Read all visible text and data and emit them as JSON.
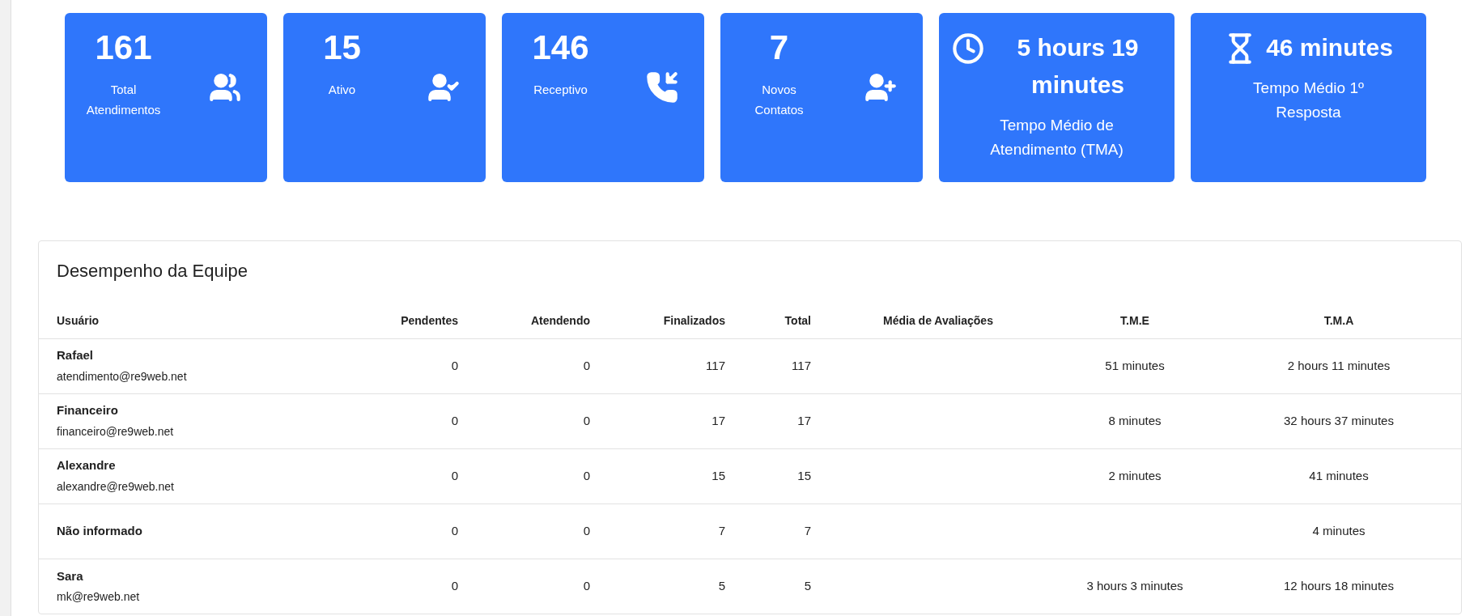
{
  "stat_cards": [
    {
      "kind": "side-icon",
      "value": "161",
      "label": "Total Atendimentos"
    },
    {
      "kind": "side-icon",
      "value": "15",
      "label": "Ativo"
    },
    {
      "kind": "side-icon",
      "value": "146",
      "label": "Receptivo"
    },
    {
      "kind": "side-icon",
      "value": "7",
      "label": "Novos Contatos"
    },
    {
      "kind": "inline-icon",
      "value": "5 hours 19 minutes",
      "label": "Tempo Médio de Atendimento (TMA)"
    },
    {
      "kind": "inline-icon",
      "value": "46 minutes",
      "label": "Tempo Médio 1º Resposta"
    }
  ],
  "team_table": {
    "title": "Desempenho da Equipe",
    "columns": [
      "Usuário",
      "Pendentes",
      "Atendendo",
      "Finalizados",
      "Total",
      "Média de Avaliações",
      "T.M.E",
      "T.M.A"
    ],
    "rows": [
      {
        "name": "Rafael",
        "email": "atendimento@re9web.net",
        "pendentes": "0",
        "atendendo": "0",
        "finalizados": "117",
        "total": "117",
        "tme": "51 minutes",
        "tma": "2 hours 11 minutes"
      },
      {
        "name": "Financeiro",
        "email": "financeiro@re9web.net",
        "pendentes": "0",
        "atendendo": "0",
        "finalizados": "17",
        "total": "17",
        "tme": "8 minutes",
        "tma": "32 hours 37 minutes"
      },
      {
        "name": "Alexandre",
        "email": "alexandre@re9web.net",
        "pendentes": "0",
        "atendendo": "0",
        "finalizados": "15",
        "total": "15",
        "tme": "2 minutes",
        "tma": "41 minutes"
      },
      {
        "name": "Não informado",
        "pendentes": "0",
        "atendendo": "0",
        "finalizados": "7",
        "total": "7",
        "tma": "4 minutes"
      },
      {
        "name": "Sara",
        "email": "mk@re9web.net",
        "pendentes": "0",
        "atendendo": "0",
        "finalizados": "5",
        "total": "5",
        "tme": "3 hours 3 minutes",
        "tma": "12 hours 18 minutes"
      }
    ]
  }
}
